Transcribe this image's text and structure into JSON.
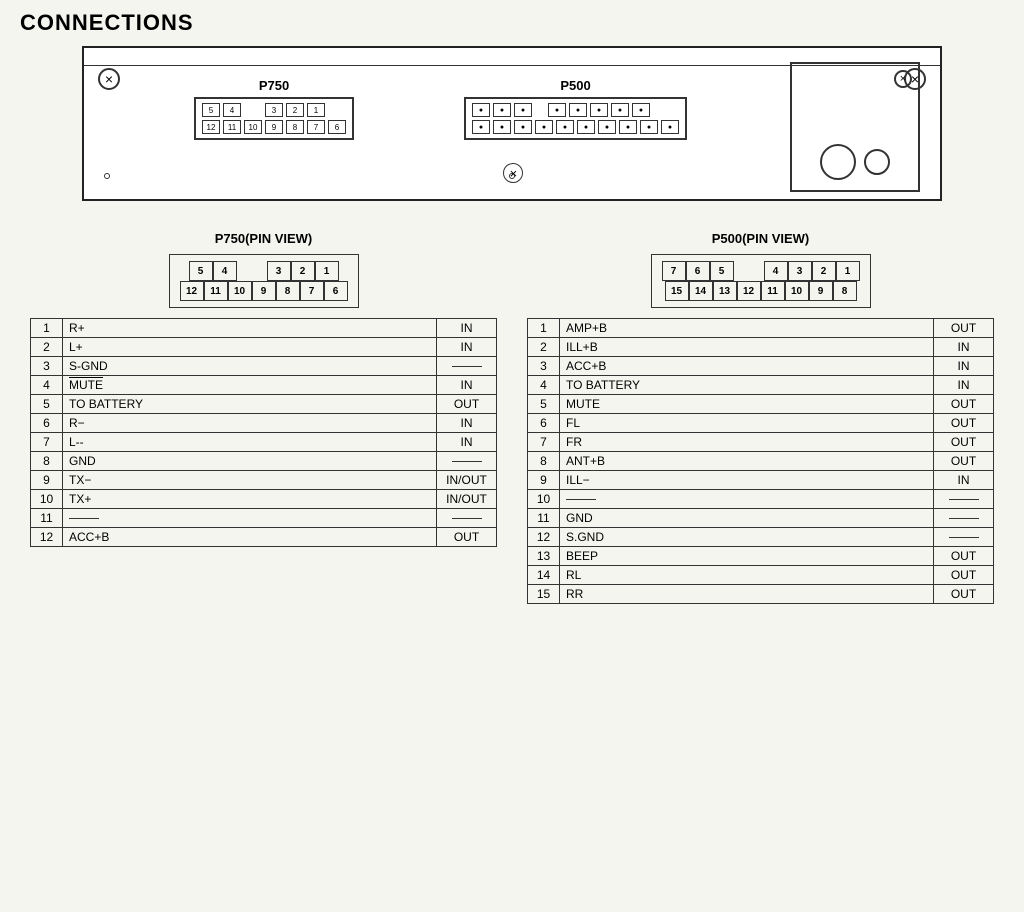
{
  "page": {
    "title": "CONNECTIONS"
  },
  "p750": {
    "label": "P750",
    "view_label": "P750(PIN VIEW)",
    "diagram": {
      "row1": [
        "5",
        "4",
        "",
        "",
        "",
        "3",
        "2",
        "1"
      ],
      "row2": [
        "12",
        "11",
        "10",
        "9",
        "8",
        "7",
        "6"
      ]
    },
    "pins": [
      {
        "num": "1",
        "name": "R+",
        "dir": "IN"
      },
      {
        "num": "2",
        "name": "L+",
        "dir": "IN"
      },
      {
        "num": "3",
        "name": "S-GND",
        "dir": "—"
      },
      {
        "num": "4",
        "name": "MUTE",
        "dir": "IN"
      },
      {
        "num": "5",
        "name": "TO BATTERY",
        "dir": "OUT"
      },
      {
        "num": "6",
        "name": "R−",
        "dir": "IN"
      },
      {
        "num": "7",
        "name": "L--",
        "dir": "IN"
      },
      {
        "num": "8",
        "name": "GND",
        "dir": "—"
      },
      {
        "num": "9",
        "name": "TX−",
        "dir": "IN/OUT"
      },
      {
        "num": "10",
        "name": "TX+",
        "dir": "IN/OUT"
      },
      {
        "num": "11",
        "name": "—",
        "dir": "—"
      },
      {
        "num": "12",
        "name": "ACC+B",
        "dir": "OUT"
      }
    ]
  },
  "p500": {
    "label": "P500",
    "view_label": "P500(PIN VIEW)",
    "diagram": {
      "row1": [
        "7",
        "6",
        "5",
        "",
        "",
        "4",
        "3",
        "2",
        "1"
      ],
      "row2": [
        "15",
        "14",
        "13",
        "12",
        "11",
        "10",
        "9",
        "8"
      ]
    },
    "pins": [
      {
        "num": "1",
        "name": "AMP+B",
        "dir": "OUT"
      },
      {
        "num": "2",
        "name": "ILL+B",
        "dir": "IN"
      },
      {
        "num": "3",
        "name": "ACC+B",
        "dir": "IN"
      },
      {
        "num": "4",
        "name": "TO BATTERY",
        "dir": "IN"
      },
      {
        "num": "5",
        "name": "MUTE",
        "dir": "OUT"
      },
      {
        "num": "6",
        "name": "FL",
        "dir": "OUT"
      },
      {
        "num": "7",
        "name": "FR",
        "dir": "OUT"
      },
      {
        "num": "8",
        "name": "ANT+B",
        "dir": "OUT"
      },
      {
        "num": "9",
        "name": "ILL−",
        "dir": "IN"
      },
      {
        "num": "10",
        "name": "—",
        "dir": "—"
      },
      {
        "num": "11",
        "name": "GND",
        "dir": "—"
      },
      {
        "num": "12",
        "name": "S.GND",
        "dir": "—"
      },
      {
        "num": "13",
        "name": "BEEP",
        "dir": "OUT"
      },
      {
        "num": "14",
        "name": "RL",
        "dir": "OUT"
      },
      {
        "num": "15",
        "name": "RR",
        "dir": "OUT"
      }
    ]
  }
}
